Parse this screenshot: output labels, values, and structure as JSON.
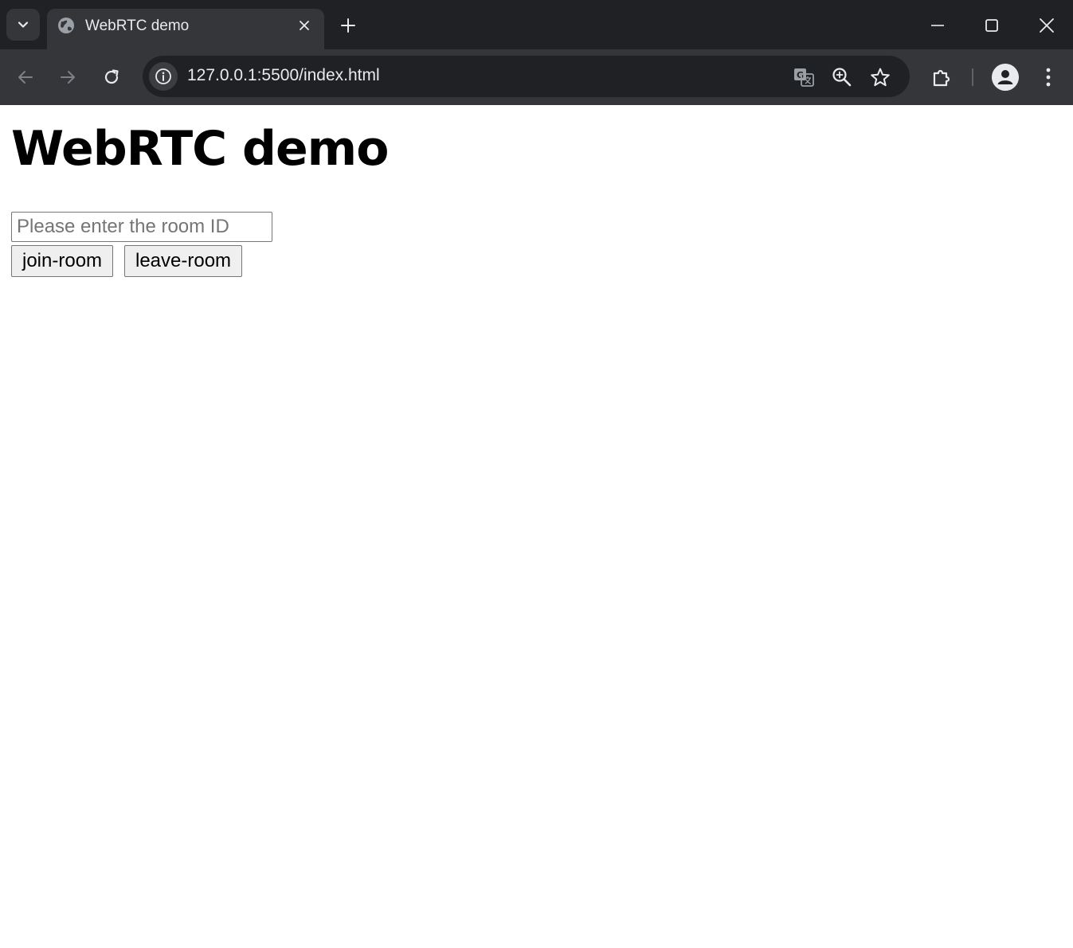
{
  "browser": {
    "tab": {
      "title": "WebRTC demo"
    },
    "address_bar": {
      "url": "127.0.0.1:5500/index.html"
    },
    "icons": {
      "tab_search": "chevron-down-icon",
      "favicon": "globe-icon",
      "tab_close": "close-icon",
      "new_tab": "plus-icon",
      "back": "arrow-left-icon",
      "forward": "arrow-right-icon",
      "reload": "reload-icon",
      "site_info": "info-icon",
      "translate": "translate-icon",
      "zoom": "zoom-icon",
      "bookmark": "star-icon",
      "extensions": "puzzle-icon",
      "profile": "avatar-icon",
      "menu": "kebab-menu-icon",
      "minimize": "minimize-icon",
      "maximize": "maximize-icon",
      "close_window": "close-icon"
    },
    "colors": {
      "frame": "#202124",
      "toolbar": "#35363a",
      "text": "#e8eaed"
    }
  },
  "page": {
    "title": "WebRTC demo",
    "room_input": {
      "placeholder": "Please enter the room ID",
      "value": ""
    },
    "join_button": "join-room",
    "leave_button": "leave-room"
  }
}
